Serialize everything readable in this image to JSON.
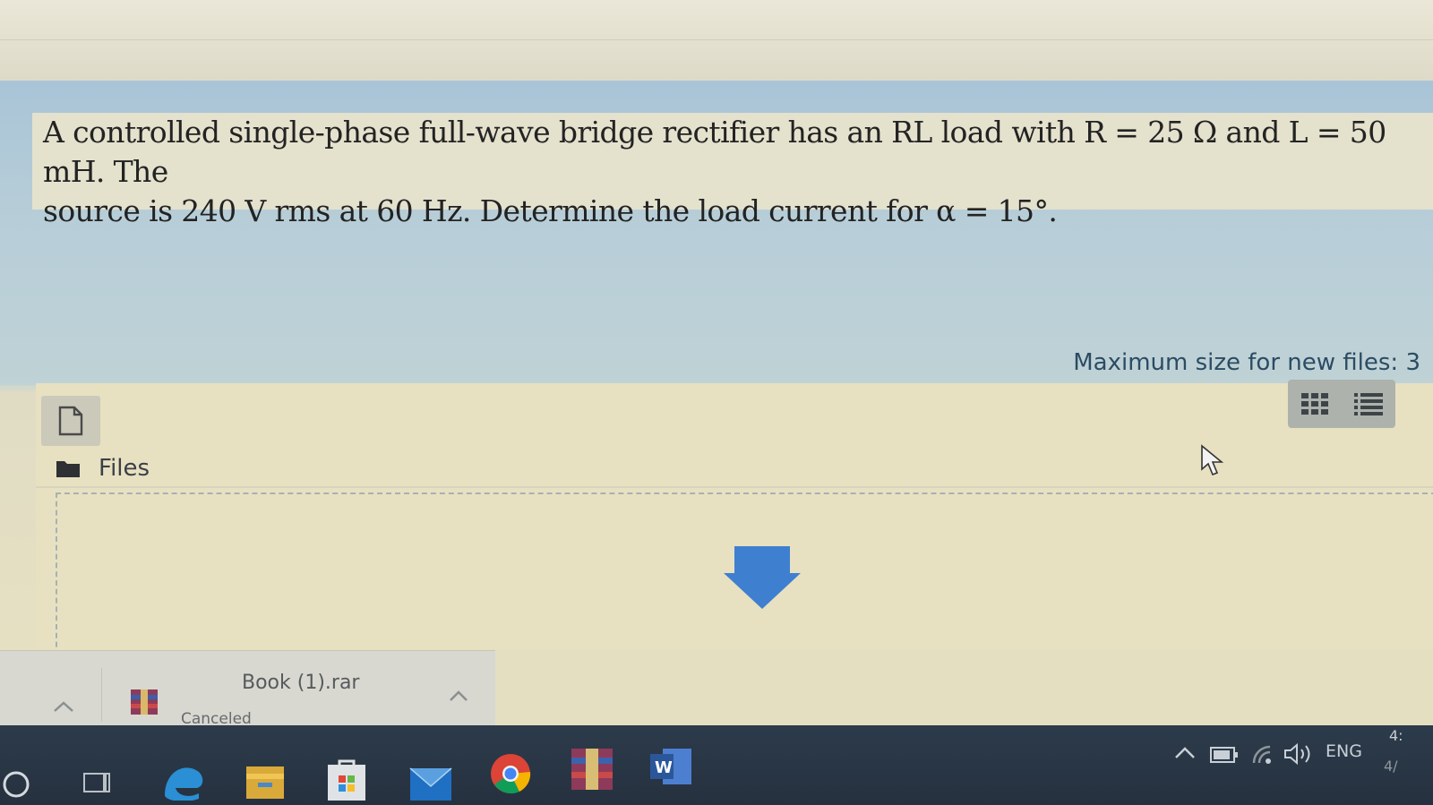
{
  "question": {
    "line1": "A controlled single-phase full-wave bridge rectifier has an RL load with R = 25 Ω and L = 50 mH. The",
    "line2": "source is 240 V rms at 60 Hz. Determine the load current for α = 15°."
  },
  "filepicker": {
    "max_size_text": "Maximum size for new files: 3",
    "breadcrumb_label": "Files",
    "icons": [
      "add-file-icon",
      "grid-view-icon",
      "list-view-icon",
      "folder-icon",
      "download-arrow-icon"
    ]
  },
  "download_bar": {
    "file_name": "Book (1).rar",
    "status": "Canceled"
  },
  "taskbar": {
    "tray": {
      "language": "ENG",
      "time": "4:",
      "date": "4/"
    },
    "apps": [
      "search-icon",
      "task-view-icon",
      "edge-icon",
      "file-explorer-icon",
      "store-icon",
      "mail-icon",
      "chrome-icon",
      "winrar-icon",
      "word-icon"
    ]
  },
  "colors": {
    "accent_blue": "#3f7fd0",
    "taskbar": "#2a3645"
  }
}
